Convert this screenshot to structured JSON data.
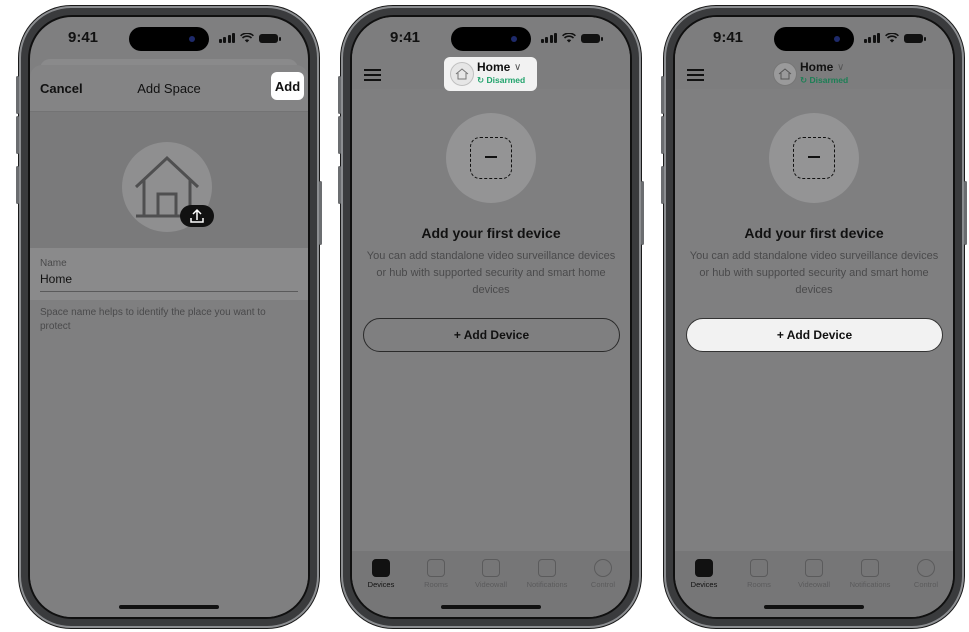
{
  "status_time": "9:41",
  "add_space": {
    "cancel": "Cancel",
    "title": "Add Space",
    "add": "Add",
    "name_label": "Name",
    "name_value": "Home",
    "hint": "Space name helps to identify the place you want to protect"
  },
  "devices_screen": {
    "hub_name": "Home",
    "hub_status": "Disarmed",
    "empty_title": "Add your first device",
    "empty_desc": "You can add standalone video surveillance devices or hub with supported security and smart home devices",
    "add_device": "+ Add Device"
  },
  "tabs": [
    "Devices",
    "Rooms",
    "Videowall",
    "Notifications",
    "Control"
  ],
  "colors": {
    "accent_green": "#21a36c",
    "overlay_gray": "#7f7f80"
  }
}
